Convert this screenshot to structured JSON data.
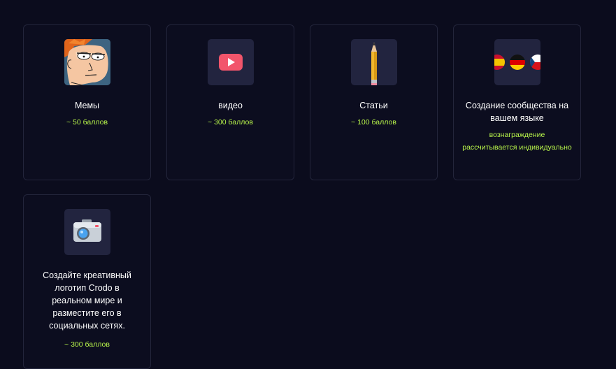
{
  "cards": [
    {
      "title": "Мемы",
      "reward": "~ 50 баллов",
      "icon": "fry-meme-icon"
    },
    {
      "title": "видео",
      "reward": "~ 300 баллов",
      "icon": "youtube-play-icon"
    },
    {
      "title": "Статьи",
      "reward": "~ 100 баллов",
      "icon": "pencil-icon"
    },
    {
      "title": "Создание сообщества на вашем языке",
      "reward": "вознаграждение рассчитывается индивидуально",
      "icon": "country-flags-icon"
    },
    {
      "title": "Создайте креативный логотип Crodo в реальном мире и разместите его в социальных сетях.",
      "reward": "~ 300 баллов",
      "icon": "camera-icon"
    }
  ],
  "colors": {
    "background": "#0b0c1d",
    "card_border": "#23253b",
    "accent_green": "#b7f34a",
    "icon_bg": "#22243f"
  }
}
